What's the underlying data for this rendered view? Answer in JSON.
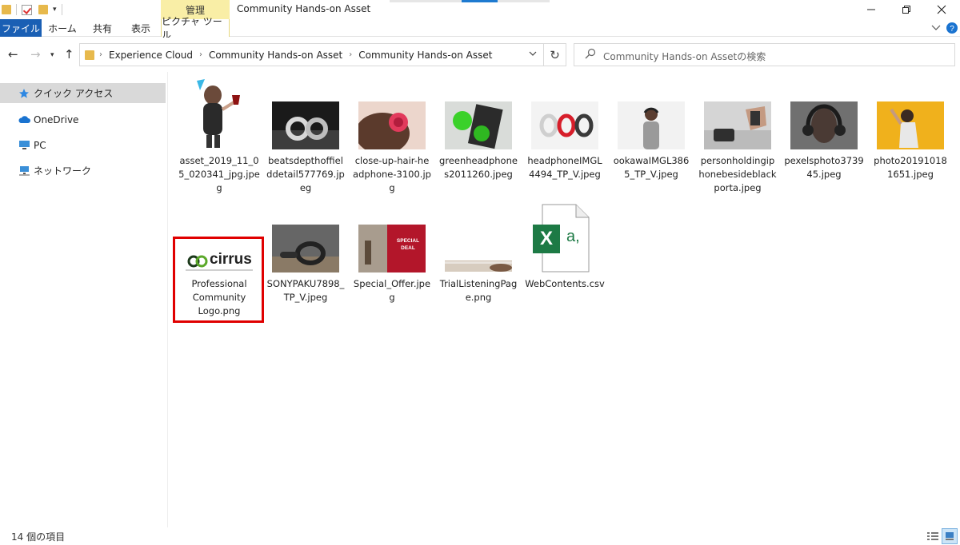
{
  "window": {
    "title": "Community Hands-on Asset",
    "context_tab_header": "管理"
  },
  "ribbon": {
    "tabs": [
      {
        "label": "ファイル"
      },
      {
        "label": "ホーム"
      },
      {
        "label": "共有"
      },
      {
        "label": "表示"
      },
      {
        "label": "ピクチャ ツール"
      }
    ]
  },
  "address": {
    "breadcrumbs": [
      "Experience Cloud",
      "Community Hands-on Asset",
      "Community Hands-on Asset"
    ]
  },
  "search": {
    "placeholder": "Community Hands-on Assetの検索"
  },
  "sidebar": {
    "items": [
      {
        "label": "クイック アクセス",
        "icon": "star-icon"
      },
      {
        "label": "OneDrive",
        "icon": "cloud-icon"
      },
      {
        "label": "PC",
        "icon": "computer-icon"
      },
      {
        "label": "ネットワーク",
        "icon": "network-icon"
      }
    ]
  },
  "files": [
    {
      "name": "asset_2019_11_05_020341_jpg.jpeg",
      "lines": [
        "asset_2019_11_0",
        "5_020341_jpg.jpe",
        "g"
      ]
    },
    {
      "name": "beatsdepthoffielddetail577769.jpeg",
      "lines": [
        "beatsdepthoffiel",
        "ddetail577769.jp",
        "eg"
      ]
    },
    {
      "name": "close-up-hair-headphone-3100.jpg",
      "lines": [
        "close-up-hair-he",
        "adphone-3100.jp",
        "g"
      ]
    },
    {
      "name": "greenheadphones2011260.jpeg",
      "lines": [
        "greenheadphone",
        "s2011260.jpeg"
      ]
    },
    {
      "name": "headphoneIMGL4494_TP_V.jpeg",
      "lines": [
        "headphoneIMGL",
        "4494_TP_V.jpeg"
      ]
    },
    {
      "name": "ookawaIMGL3865_TP_V.jpeg",
      "lines": [
        "ookawaIMGL386",
        "5_TP_V.jpeg"
      ]
    },
    {
      "name": "personholdingiphonebesideblackporta.jpeg",
      "lines": [
        "personholdingip",
        "honebesideblack",
        "porta.jpeg"
      ]
    },
    {
      "name": "pexelsphoto373945.jpeg",
      "lines": [
        "pexelsphoto3739",
        "45.jpeg"
      ]
    },
    {
      "name": "photo201910181651.jpeg",
      "lines": [
        "photo20191018",
        "1651.jpeg"
      ]
    },
    {
      "name": "Professional Community Logo.png",
      "lines": [
        "Professional",
        "Community",
        "Logo.png"
      ],
      "logo_text": "cirrus"
    },
    {
      "name": "SONYPAKU7898_TP_V.jpeg",
      "lines": [
        "SONYPAKU7898_",
        "TP_V.jpeg"
      ]
    },
    {
      "name": "Special_Offer.jpeg",
      "lines": [
        "Special_Offer.jpe",
        "g"
      ],
      "thumb_text": [
        "SPECIAL",
        "DEAL"
      ]
    },
    {
      "name": "TrialListeningPage.png",
      "lines": [
        "TrialListeningPag",
        "e.png"
      ]
    },
    {
      "name": "WebContents.csv",
      "lines": [
        "WebContents.csv"
      ],
      "icon_text": "X",
      "icon_sub": "a,"
    }
  ],
  "status": {
    "item_count": "14 個の項目"
  },
  "colors": {
    "file_tab": "#1a5fb4",
    "manage_tab": "#f9eea6",
    "highlight": "#e00000",
    "excel_green": "#1d7a45"
  }
}
